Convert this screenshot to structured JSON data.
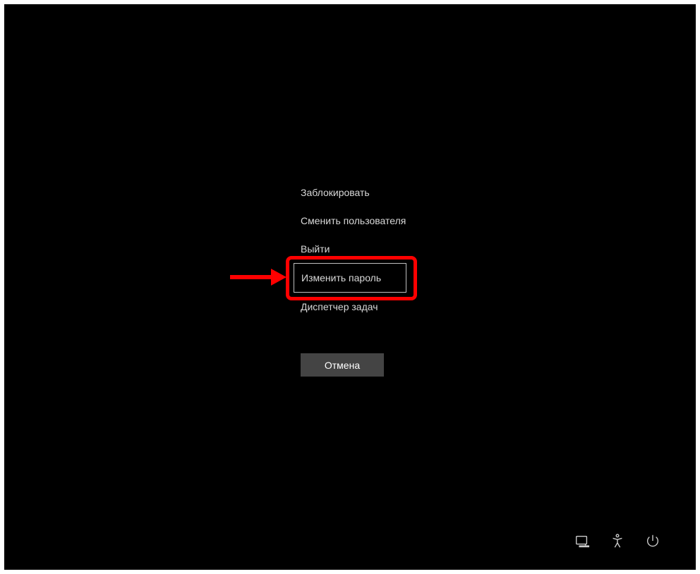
{
  "menu": {
    "items": [
      {
        "label": "Заблокировать"
      },
      {
        "label": "Сменить пользователя"
      },
      {
        "label": "Выйти"
      },
      {
        "label": "Изменить пароль"
      },
      {
        "label": "Диспетчер задач"
      }
    ]
  },
  "cancel": {
    "label": "Отмена"
  },
  "annotation": {
    "highlighted_index": 3
  },
  "icons": {
    "network": "network-icon",
    "accessibility": "accessibility-icon",
    "power": "power-icon"
  }
}
